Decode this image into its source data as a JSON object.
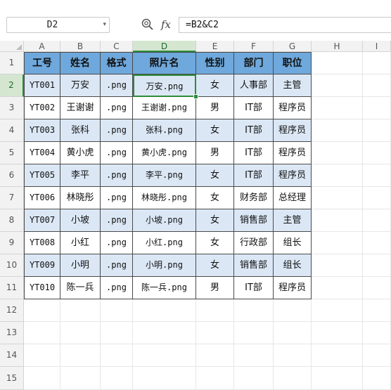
{
  "formula_bar": {
    "name_box": "D2",
    "fx_label": "fx",
    "formula": "=B2&C2"
  },
  "columns": [
    "A",
    "B",
    "C",
    "D",
    "E",
    "F",
    "G",
    "H",
    "I"
  ],
  "active_column": "D",
  "active_row": 2,
  "row_numbers": [
    "1",
    "2",
    "3",
    "4",
    "5",
    "6",
    "7",
    "8",
    "9",
    "10",
    "11",
    "12",
    "13",
    "14",
    "15"
  ],
  "table": {
    "headers": [
      "工号",
      "姓名",
      "格式",
      "照片名",
      "性别",
      "部门",
      "职位"
    ],
    "rows": [
      [
        "YT001",
        "万安",
        ".png",
        "万安.png",
        "女",
        "人事部",
        "主管"
      ],
      [
        "YT002",
        "王谢谢",
        ".png",
        "王谢谢.png",
        "男",
        "IT部",
        "程序员"
      ],
      [
        "YT003",
        "张科",
        ".png",
        "张科.png",
        "女",
        "IT部",
        "程序员"
      ],
      [
        "YT004",
        "黄小虎",
        ".png",
        "黄小虎.png",
        "男",
        "IT部",
        "程序员"
      ],
      [
        "YT005",
        "李平",
        ".png",
        "李平.png",
        "女",
        "IT部",
        "程序员"
      ],
      [
        "YT006",
        "林晓彤",
        ".png",
        "林晓彤.png",
        "女",
        "财务部",
        "总经理"
      ],
      [
        "YT007",
        "小坡",
        ".png",
        "小坡.png",
        "女",
        "销售部",
        "主管"
      ],
      [
        "YT008",
        "小红",
        ".png",
        "小红.png",
        "女",
        "行政部",
        "组长"
      ],
      [
        "YT009",
        "小明",
        ".png",
        "小明.png",
        "女",
        "销售部",
        "组长"
      ],
      [
        "YT010",
        "陈一兵",
        ".png",
        "陈一兵.png",
        "男",
        "IT部",
        "程序员"
      ]
    ]
  },
  "colors": {
    "header_fill": "#6fa8dc",
    "band_fill": "#dbe7f5",
    "selection": "#2e8b3a"
  }
}
